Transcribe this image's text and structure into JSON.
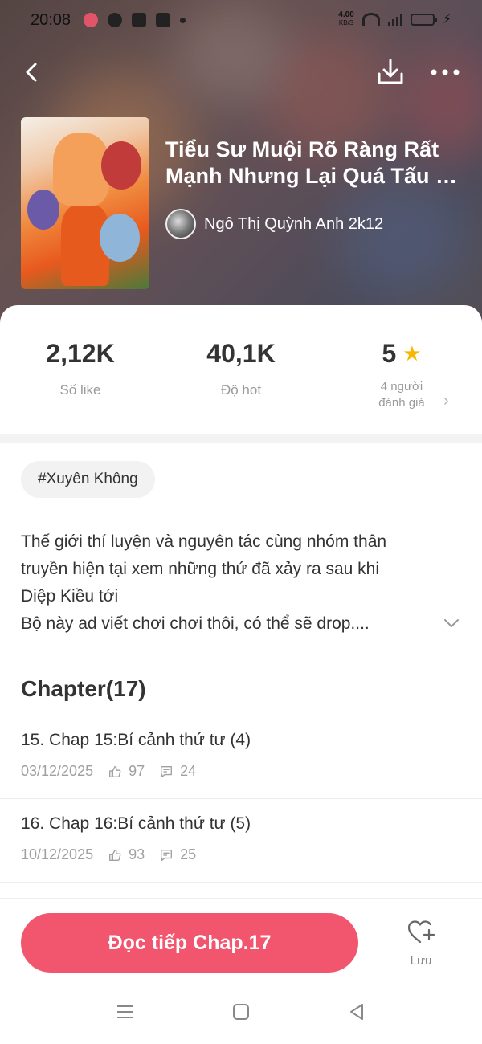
{
  "status_bar": {
    "time": "20:08",
    "net_speed_value": "4.00",
    "net_speed_unit": "KB/S"
  },
  "story": {
    "title": "Tiểu Sư Muội Rõ Ràng Rất Mạnh Nhưng Lại Quá Tấu …",
    "author": "Ngô Thị Quỳnh Anh 2k12"
  },
  "stats": {
    "likes_value": "2,12K",
    "likes_label": "Số like",
    "hot_value": "40,1K",
    "hot_label": "Độ hot",
    "rating_value": "5",
    "rating_label_line1": "4 người",
    "rating_label_line2": "đánh giá"
  },
  "tag": "#Xuyên Không",
  "description": {
    "line1": "Thế giới thí luyện và nguyên tác cùng nhóm thân",
    "line2": "truyền hiện tại xem những thứ đã xảy ra sau khi",
    "line3": "Diệp Kiều tới",
    "line4": "Bộ này ad viết chơi chơi thôi, có thể sẽ drop...."
  },
  "chapters": {
    "heading": "Chapter(17)",
    "items": [
      {
        "title": "15. Chap 15:Bí cảnh thứ tư (4)",
        "date": "03/12/2025",
        "likes": "97",
        "comments": "24"
      },
      {
        "title": "16. Chap 16:Bí cảnh thứ tư (5)",
        "date": "10/12/2025",
        "likes": "93",
        "comments": "25"
      }
    ]
  },
  "actions": {
    "read_button": "Đọc tiếp Chap.17",
    "save_label": "Lưu"
  },
  "colors": {
    "accent": "#f2566e",
    "star": "#f6b800"
  },
  "icons": [
    "back-icon",
    "download-icon",
    "more-icon",
    "star-icon",
    "chevron-right-icon",
    "chevron-down-icon",
    "like-icon",
    "comment-icon",
    "heart-plus-icon",
    "nav-menu-icon",
    "nav-home-icon",
    "nav-back-icon"
  ]
}
